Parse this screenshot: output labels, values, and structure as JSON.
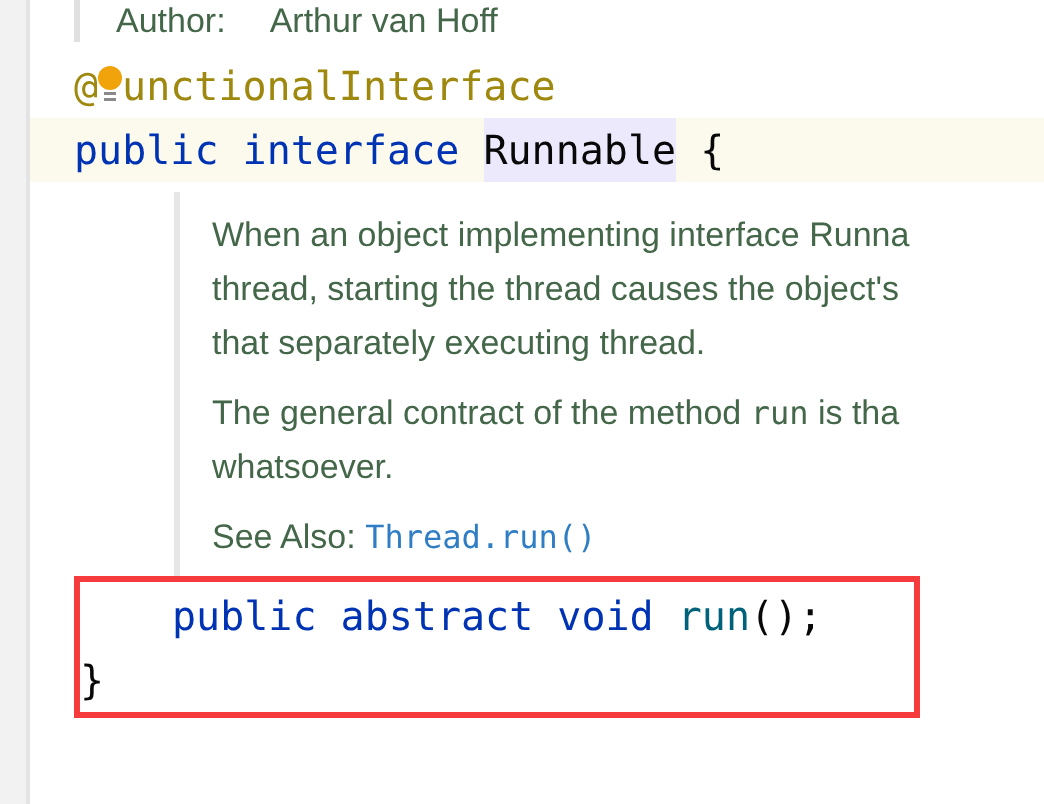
{
  "author": {
    "label": "Author:",
    "value": "Arthur van Hoff"
  },
  "code_before": [
    {
      "current": false,
      "tokens": [
        {
          "kind": "annotation",
          "text": "@"
        },
        {
          "kind": "bulb"
        },
        {
          "kind": "annotation",
          "text": "unctionalInterface"
        }
      ]
    },
    {
      "current": true,
      "tokens": [
        {
          "kind": "keyword",
          "text": "public "
        },
        {
          "kind": "keyword",
          "text": "interface "
        },
        {
          "kind": "class",
          "text": "Runnable",
          "highlighted": true
        },
        {
          "kind": "plain",
          "text": " {"
        }
      ]
    }
  ],
  "doc": {
    "paragraphs": [
      {
        "lines": [
          [
            {
              "kind": "text",
              "text": "When an object implementing interface Runna"
            }
          ],
          [
            {
              "kind": "text",
              "text": "thread, starting the thread causes the object's"
            }
          ],
          [
            {
              "kind": "text",
              "text": "that separately executing thread."
            }
          ]
        ]
      },
      {
        "lines": [
          [
            {
              "kind": "text",
              "text": "The general contract of the method "
            },
            {
              "kind": "code",
              "text": "run"
            },
            {
              "kind": "text",
              "text": " is tha"
            }
          ],
          [
            {
              "kind": "text",
              "text": "whatsoever."
            }
          ]
        ]
      },
      {
        "lines": [
          [
            {
              "kind": "text",
              "text": "See Also: "
            },
            {
              "kind": "link",
              "text": "Thread.run()"
            }
          ]
        ]
      }
    ]
  },
  "code_after": {
    "framed": true,
    "lines": [
      {
        "indent": true,
        "tokens": [
          {
            "kind": "keyword",
            "text": "public "
          },
          {
            "kind": "keyword",
            "text": "abstract "
          },
          {
            "kind": "keyword",
            "text": "void "
          },
          {
            "kind": "method",
            "text": "run"
          },
          {
            "kind": "plain",
            "text": "();"
          }
        ]
      },
      {
        "indent": false,
        "tokens": [
          {
            "kind": "plain",
            "text": "}"
          }
        ]
      }
    ]
  }
}
